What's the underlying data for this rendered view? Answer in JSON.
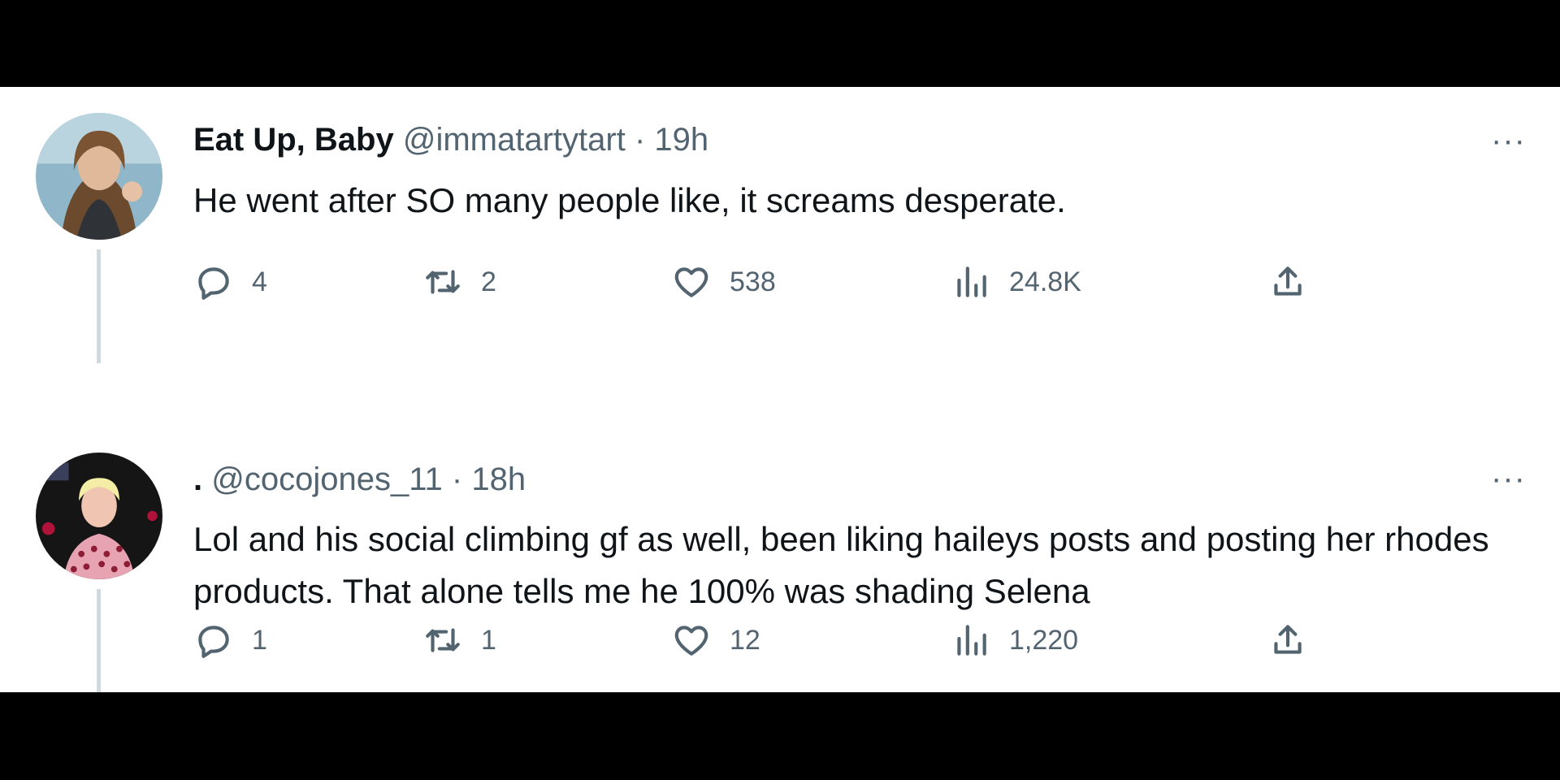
{
  "tweets": [
    {
      "display_name": "Eat Up, Baby",
      "handle": "@immatartytart",
      "separator": "·",
      "time": "19h",
      "more": "···",
      "text": "He went after SO many people like, it screams desperate.",
      "replies": "4",
      "retweets": "2",
      "likes": "538",
      "views": "24.8K"
    },
    {
      "display_name": ".",
      "handle": "@cocojones_11",
      "separator": "·",
      "time": "18h",
      "more": "···",
      "text": "Lol and his social climbing gf as well, been liking haileys posts and posting her rhodes products. That alone tells me he 100% was shading Selena",
      "replies": "1",
      "retweets": "1",
      "likes": "12",
      "views": "1,220"
    }
  ],
  "icons": {
    "reply": "reply-icon",
    "retweet": "retweet-icon",
    "like": "heart-icon",
    "views": "views-icon",
    "share": "share-icon",
    "more": "more-icon"
  },
  "colors": {
    "text_primary": "#0f1419",
    "text_secondary": "#536471",
    "thread_line": "#cfd9de",
    "background": "#ffffff"
  }
}
